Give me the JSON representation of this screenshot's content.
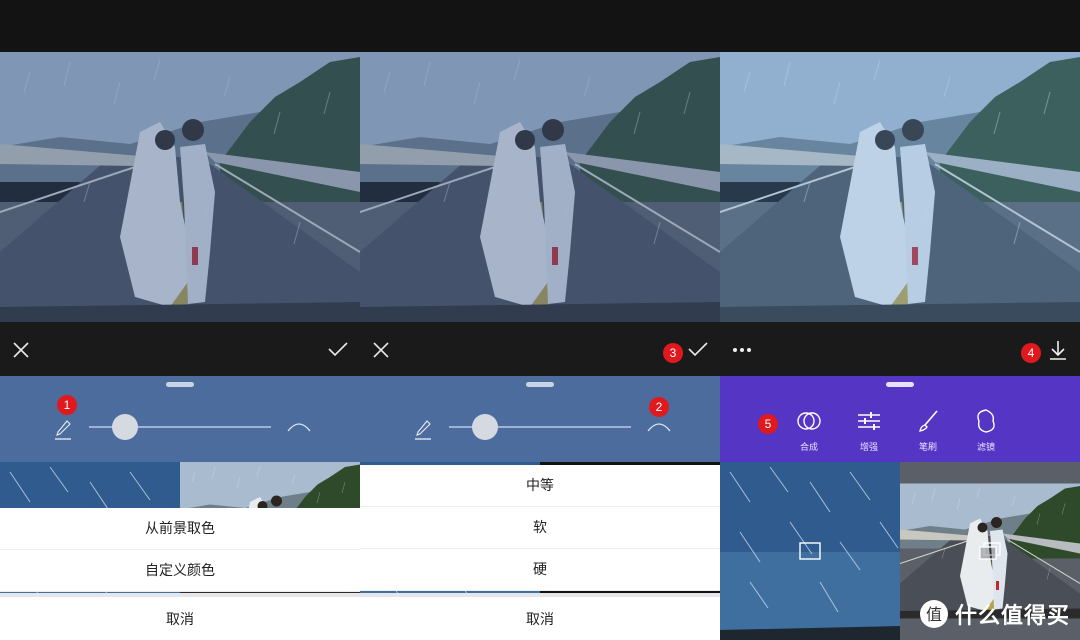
{
  "colors": {
    "blue_strip": "#4d6c9e",
    "purple_strip": "#5435c4",
    "badge_red": "#e0191e"
  },
  "panel1": {
    "badge": "1",
    "sheet_options": [
      "从前景取色",
      "自定义颜色"
    ],
    "cancel_label": "取消"
  },
  "panel2": {
    "badge_check": "3",
    "badge_arc": "2",
    "sheet_options": [
      "中等",
      "软",
      "硬"
    ],
    "cancel_label": "取消"
  },
  "panel3": {
    "badge_download": "4",
    "badge_tools": "5",
    "tools": [
      {
        "label": "合成",
        "icon": "blend-circles-icon"
      },
      {
        "label": "增强",
        "icon": "sliders-icon"
      },
      {
        "label": "笔刷",
        "icon": "brush-icon"
      },
      {
        "label": "滤镜",
        "icon": "filter-icon"
      }
    ],
    "watermark": "什么值得买"
  },
  "slider_value": 0.2
}
